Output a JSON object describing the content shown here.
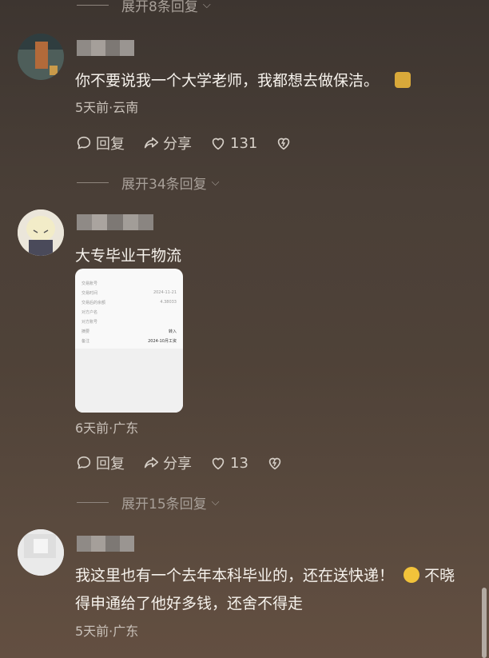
{
  "expands": [
    {
      "label": "展开8条回复"
    },
    {
      "label": "展开34条回复"
    },
    {
      "label": "展开15条回复"
    }
  ],
  "comments": [
    {
      "text": "你不要说我一个大学老师，我都想去做保洁。",
      "meta": "5天前·云南",
      "reply": "回复",
      "share": "分享",
      "likes": "131"
    },
    {
      "text": "大专毕业干物流",
      "meta": "6天前·广东",
      "reply": "回复",
      "share": "分享",
      "likes": "13",
      "receipt": [
        {
          "k": "交易账号",
          "v": ""
        },
        {
          "k": "交易时间",
          "v": "2024-11-21"
        },
        {
          "k": "交易后的余额",
          "v": "4.38033"
        },
        {
          "k": "对方户名",
          "v": ""
        },
        {
          "k": "对方账号",
          "v": ""
        },
        {
          "k": "摘要",
          "v": "转入"
        },
        {
          "k": "备注",
          "v": "2024-10月工资"
        }
      ]
    },
    {
      "text_line1": "我这里也有一个去年本科毕业的，还在送快递！",
      "text_line1b": "不晓",
      "text_line2": "得申通给了他好多钱，还舍不得走",
      "meta": "5天前·广东"
    }
  ],
  "colors": {
    "accent": "#f3efe9",
    "meta": "#c9c1b9"
  },
  "icons": [
    "chevron-down-icon",
    "reply-icon",
    "share-icon",
    "heart-icon",
    "dislike-icon"
  ]
}
